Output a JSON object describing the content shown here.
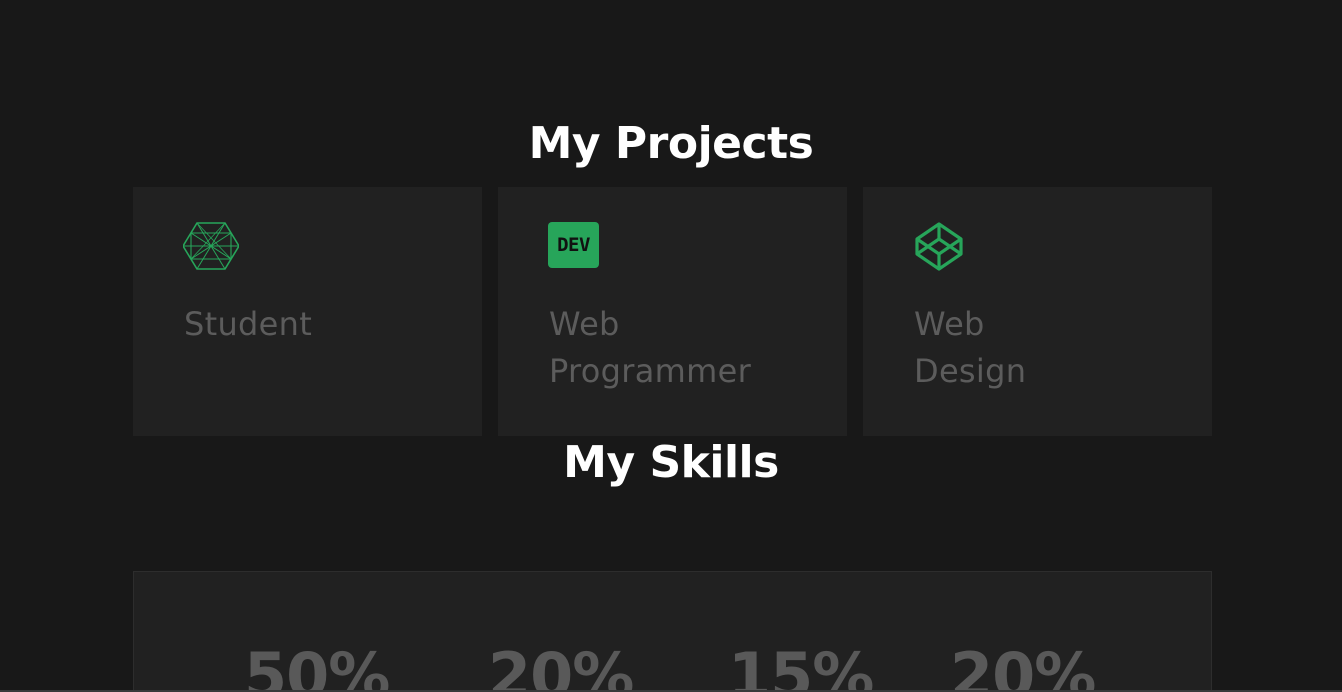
{
  "projects": {
    "title": "My Projects",
    "cards": [
      {
        "icon": "hexagon-wireframe-icon",
        "label_lines": [
          "Student"
        ]
      },
      {
        "icon": "dev-badge-icon",
        "badge_text": "DEV",
        "label_lines": [
          "Web",
          "Programmer"
        ]
      },
      {
        "icon": "codepen-cube-icon",
        "label_lines": [
          "Web",
          "Design"
        ]
      }
    ]
  },
  "skills": {
    "title": "My Skills",
    "values": [
      "50%",
      "20%",
      "15%",
      "20%"
    ]
  },
  "colors": {
    "background": "#181818",
    "card": "#212121",
    "accent": "#27a55a",
    "title": "#ffffff",
    "muted_text": "#5c5c5c"
  }
}
